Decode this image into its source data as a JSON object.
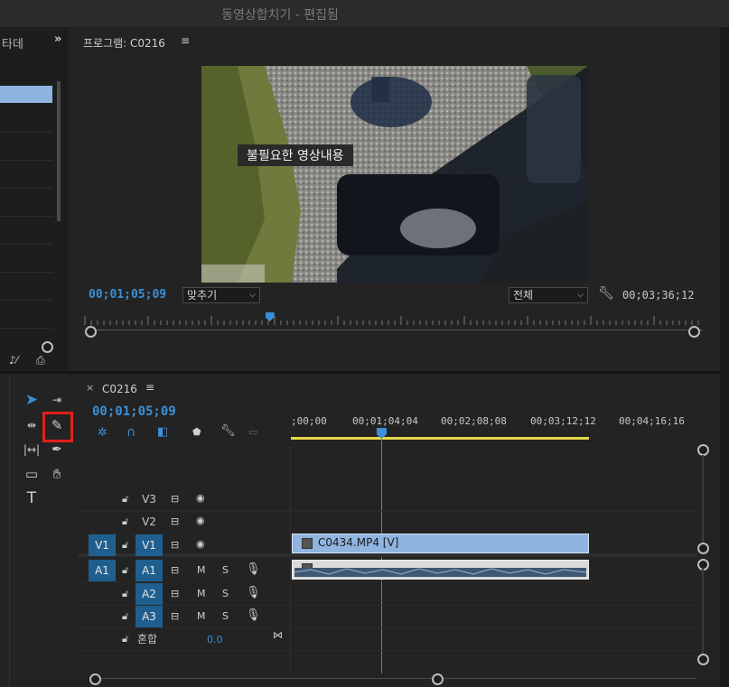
{
  "window": {
    "title": "동영상합치기 - 편집됨"
  },
  "left_panel": {
    "tab_label": "타데",
    "expand_icon": "double-chevron-right-icon"
  },
  "program_monitor": {
    "tab_label": "프로그램: C0216",
    "caption": "불필요한 영상내용",
    "current_time": "00;01;05;09",
    "fit_dropdown": "맞추기",
    "quality_dropdown": "전체",
    "duration": "00;03;36;12",
    "playhead_fraction": 0.3
  },
  "timeline": {
    "tab_label": "C0216",
    "current_time": "00;01;05;09",
    "ruler_labels": [
      ";00;00",
      "00;01;04;04",
      "00;02;08;08",
      "00;03;12;12",
      "00;04;16;16"
    ],
    "video_tracks": [
      {
        "name": "V3",
        "source": "",
        "selected": false
      },
      {
        "name": "V2",
        "source": "",
        "selected": false
      },
      {
        "name": "V1",
        "source": "V1",
        "selected": true
      }
    ],
    "audio_tracks": [
      {
        "name": "A1",
        "source": "A1",
        "selected": true
      },
      {
        "name": "A2",
        "source": "",
        "selected": false
      },
      {
        "name": "A3",
        "source": "",
        "selected": false
      }
    ],
    "mute_label": "M",
    "solo_label": "S",
    "mix_label": "혼합",
    "mix_value": "0.0",
    "video_clip": "C0434.MP4 [V]"
  },
  "tools": {
    "highlighted_tool": "razor-tool",
    "type_tool_label": "T"
  },
  "colors": {
    "accent": "#3b8fd8",
    "clip_video": "#8fb4e0",
    "highlight": "#e0201b"
  }
}
